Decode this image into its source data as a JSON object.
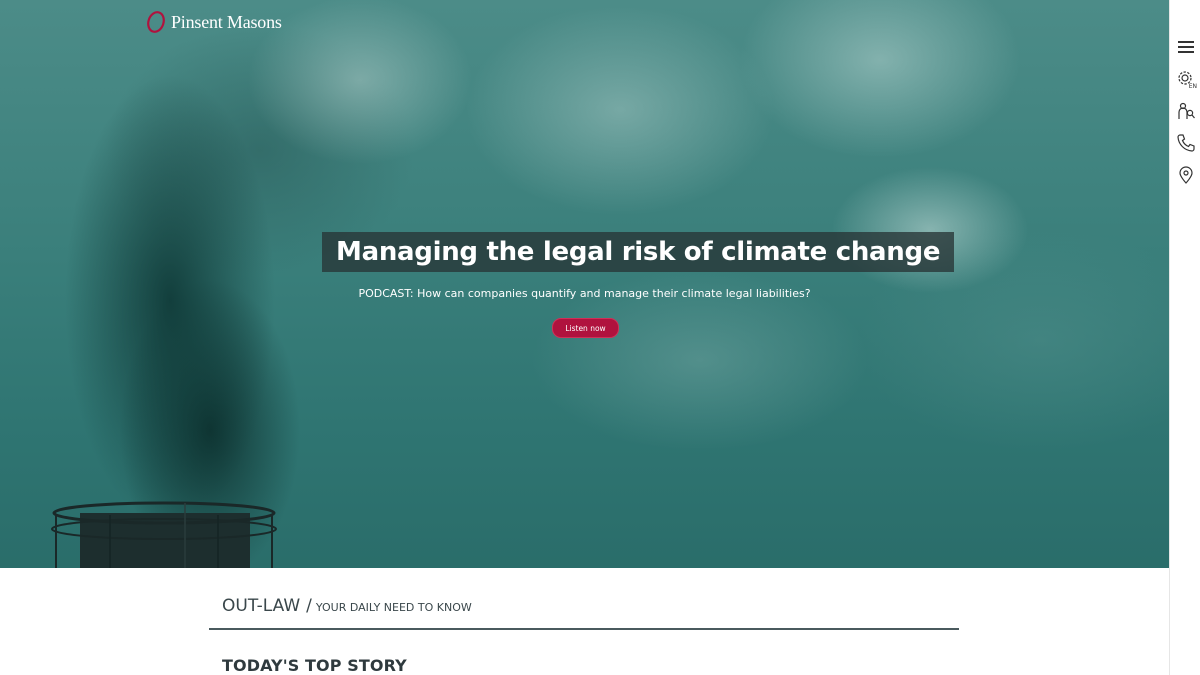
{
  "brand": {
    "name": "Pinsent Masons",
    "accent_color": "#b0123e"
  },
  "hero": {
    "headline": "Managing the legal risk of climate change",
    "subline": "PODCAST: How can companies quantify and manage their climate legal liabilities?",
    "cta_label": "Listen now",
    "background_color": "#3a7f7b"
  },
  "rail": {
    "items": [
      {
        "icon": "hamburger-menu-icon"
      },
      {
        "icon": "language-gear-icon",
        "label": "EN"
      },
      {
        "icon": "find-people-icon"
      },
      {
        "icon": "phone-icon"
      },
      {
        "icon": "location-pin-icon"
      }
    ]
  },
  "outlaw": {
    "title": "OUT-LAW",
    "separator": "/",
    "subtitle": "YOUR DAILY NEED TO KNOW"
  },
  "top_story": {
    "heading": "TODAY'S TOP STORY"
  }
}
